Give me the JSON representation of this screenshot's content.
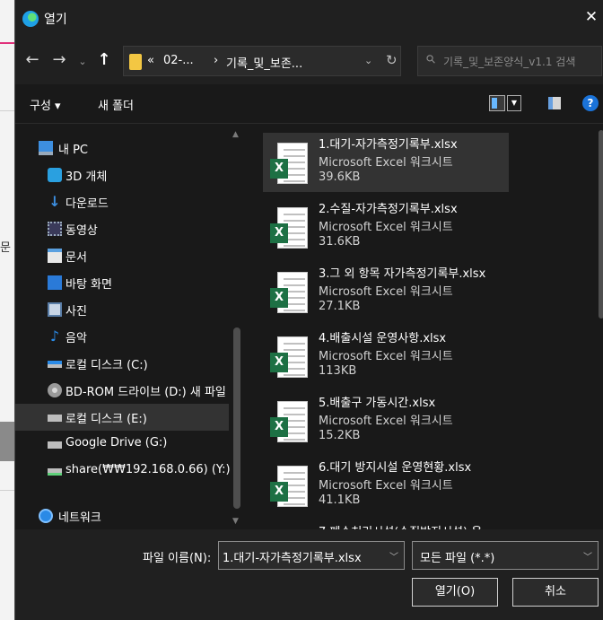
{
  "background": {
    "fragment": "문"
  },
  "window": {
    "title": "열기",
    "close": "✕"
  },
  "nav": {
    "back": "←",
    "forward": "→",
    "recent": "⌄",
    "up": "↑"
  },
  "address": {
    "seg1": "«",
    "seg2": "02-...",
    "sep1": "›",
    "seg3": "기록_및_보존...",
    "dropdown": "⌄",
    "refresh": "↻"
  },
  "search": {
    "placeholder": "기록_및_보존양식_v1.1 검색"
  },
  "toolbar": {
    "organize": "구성 ▾",
    "new_folder": "새 폴더",
    "help": "?"
  },
  "sidebar": {
    "items": [
      {
        "label": "내 PC"
      },
      {
        "label": "3D 개체"
      },
      {
        "label": "다운로드"
      },
      {
        "label": "동영상"
      },
      {
        "label": "문서"
      },
      {
        "label": "바탕 화면"
      },
      {
        "label": "사진"
      },
      {
        "label": "음악"
      },
      {
        "label": "로컬 디스크 (C:)"
      },
      {
        "label": "BD-ROM 드라이브 (D:) 새 파일"
      },
      {
        "label": "로컬 디스크 (E:)"
      },
      {
        "label": "Google Drive (G:)"
      },
      {
        "label": "share(₩₩192.168.0.66) (Y:)"
      },
      {
        "label": "네트워크"
      }
    ]
  },
  "files": [
    {
      "name": "1.대기-자가측정기록부.xlsx",
      "type": "Microsoft Excel 워크시트",
      "size": "39.6KB"
    },
    {
      "name": "2.수질-자가측정기록부.xlsx",
      "type": "Microsoft Excel 워크시트",
      "size": "31.6KB"
    },
    {
      "name": "3.그 외 항목 자가측정기록부.xlsx",
      "type": "Microsoft Excel 워크시트",
      "size": "27.1KB"
    },
    {
      "name": "4.배출시설 운영사항.xlsx",
      "type": "Microsoft Excel 워크시트",
      "size": "113KB"
    },
    {
      "name": "5.배출구 가동시간.xlsx",
      "type": "Microsoft Excel 워크시트",
      "size": "15.2KB"
    },
    {
      "name": "6.대기 방지시설 운영현황.xlsx",
      "type": "Microsoft Excel 워크시트",
      "size": "41.1KB"
    },
    {
      "name": "7.폐수처리시설(수질방지시설) 운",
      "type": "",
      "size": ""
    }
  ],
  "excel_badge": "X",
  "bottom": {
    "filename_label": "파일 이름(N):",
    "filename_value": "1.대기-자가측정기록부.xlsx",
    "filetype_value": "모든 파일 (*.*)",
    "open_button": "열기(O)",
    "cancel_button": "취소"
  },
  "colors": {
    "dialog_bg": "#191919",
    "header_bg": "#202020",
    "selection": "#333333",
    "excel_green": "#1d7044",
    "accent_blue": "#1b73d8"
  }
}
